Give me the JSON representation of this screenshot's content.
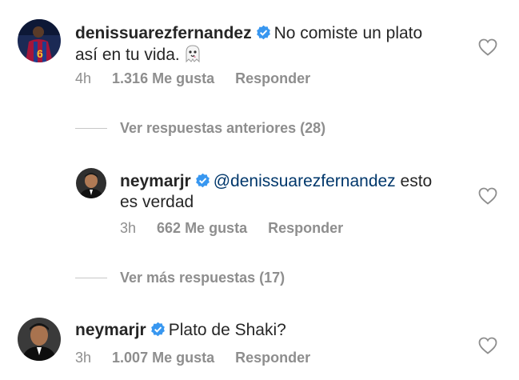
{
  "comments": [
    {
      "username": "denissuarezfernandez",
      "verified": true,
      "text_line1": "No comiste un plato",
      "text_line2": "así en tu vida.",
      "emoji": "ghost-emoji",
      "time": "4h",
      "likes": "1.316 Me gusta",
      "reply": "Responder"
    },
    {
      "username": "neymarjr",
      "verified": true,
      "mention": "@denissuarezfernandez",
      "text_after_mention": "esto",
      "text_line2": "es verdad",
      "time": "3h",
      "likes": "662 Me gusta",
      "reply": "Responder"
    },
    {
      "username": "neymarjr",
      "verified": true,
      "text_line1": "Plato de Shaki?",
      "time": "3h",
      "likes": "1.007 Me gusta",
      "reply": "Responder"
    }
  ],
  "toggles": {
    "previous_replies": "Ver respuestas anteriores (28)",
    "more_replies": "Ver más respuestas (17)"
  },
  "colors": {
    "text": "#262626",
    "meta": "#8e8e8e",
    "mention": "#00376b",
    "verified": "#3897f0"
  },
  "icons": [
    "verified-badge-icon",
    "heart-icon",
    "ghost-emoji"
  ]
}
